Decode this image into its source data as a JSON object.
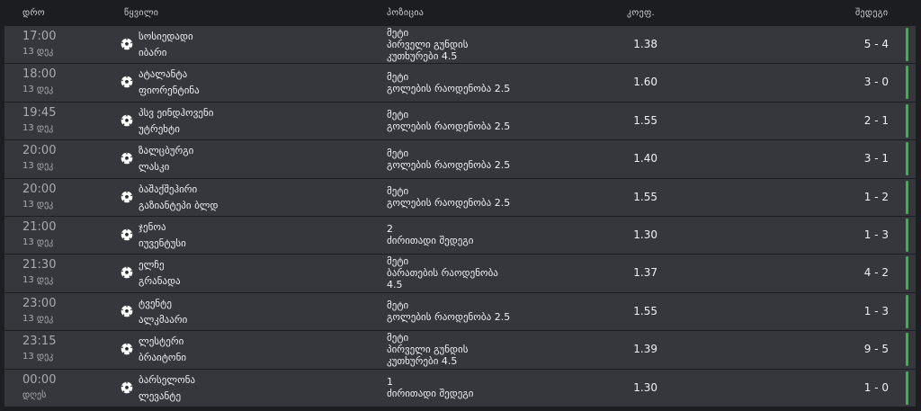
{
  "header": {
    "time": "დრო",
    "event": "წყვილი",
    "position": "პოზიცია",
    "coef": "კოეფ.",
    "result": "შედეგი"
  },
  "rows": [
    {
      "time": "17:00",
      "date": "13 დეკ",
      "team1": "სოსიედადი",
      "team2": "იბარი",
      "pos": [
        "მეტი",
        "პირველი გუნდის",
        "კუთხურები 4.5"
      ],
      "coef": "1.38",
      "score": "5 - 4"
    },
    {
      "time": "18:00",
      "date": "13 დეკ",
      "team1": "ატალანტა",
      "team2": "ფიორენტინა",
      "pos": [
        "მეტი",
        "გოლების რაოდენობა 2.5"
      ],
      "coef": "1.60",
      "score": "3 - 0"
    },
    {
      "time": "19:45",
      "date": "13 დეკ",
      "team1": "პსვ ეინდჰოვენი",
      "team2": "უტრეხტი",
      "pos": [
        "მეტი",
        "გოლების რაოდენობა 2.5"
      ],
      "coef": "1.55",
      "score": "2 - 1"
    },
    {
      "time": "20:00",
      "date": "13 დეკ",
      "team1": "ზალცბურგი",
      "team2": "ლასკი",
      "pos": [
        "მეტი",
        "გოლების რაოდენობა 2.5"
      ],
      "coef": "1.40",
      "score": "3 - 1"
    },
    {
      "time": "20:00",
      "date": "13 დეკ",
      "team1": "ბაშაქშეჰირი",
      "team2": "გაზიანტეპი ბლდ",
      "pos": [
        "მეტი",
        "გოლების რაოდენობა 2.5"
      ],
      "coef": "1.55",
      "score": "1 - 2"
    },
    {
      "time": "21:00",
      "date": "13 დეკ",
      "team1": "ჯენოა",
      "team2": "იუვენტუსი",
      "pos": [
        "2",
        "ძირითადი შედეგი"
      ],
      "coef": "1.30",
      "score": "1 - 3"
    },
    {
      "time": "21:30",
      "date": "13 დეკ",
      "team1": "ელჩე",
      "team2": "გრანადა",
      "pos": [
        "მეტი",
        "ბარათების რაოდენობა",
        "4.5"
      ],
      "coef": "1.37",
      "score": "4 - 2"
    },
    {
      "time": "23:00",
      "date": "13 დეკ",
      "team1": "ტვენტე",
      "team2": "ალკმაარი",
      "pos": [
        "მეტი",
        "გოლების რაოდენობა 2.5"
      ],
      "coef": "1.55",
      "score": "1 - 3"
    },
    {
      "time": "23:15",
      "date": "13 დეკ",
      "team1": "ლესტერი",
      "team2": "ბრაიტონი",
      "pos": [
        "მეტი",
        "პირველი გუნდის",
        "კუთხურები 4.5"
      ],
      "coef": "1.39",
      "score": "9 - 5"
    },
    {
      "time": "00:00",
      "date": "დღეს",
      "team1": "ბარსელონა",
      "team2": "ლევანტე",
      "pos": [
        "1",
        "ძირითადი შედეგი"
      ],
      "coef": "1.30",
      "score": "1 - 0"
    }
  ],
  "colors": {
    "win_bar": "#3bb54a",
    "row_bg": "#35373d"
  },
  "icons": {
    "sport": "soccer-ball-icon"
  }
}
